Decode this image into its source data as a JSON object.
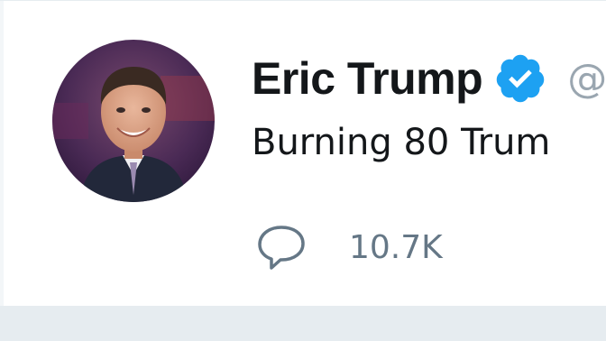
{
  "tweet": {
    "author": {
      "display_name": "Eric Trump",
      "verified": true,
      "avatar_icon": "profile-photo",
      "handle_icon": "at-sign-icon"
    },
    "text": "Burning 80 Trum",
    "stats": {
      "reply_icon": "reply-bubble-icon",
      "reply_count": "10.7K"
    }
  },
  "colors": {
    "background": "#e6ecf0",
    "card": "#ffffff",
    "text": "#14171a",
    "secondary_text": "#657786",
    "verified_badge": "#1da1f2"
  }
}
